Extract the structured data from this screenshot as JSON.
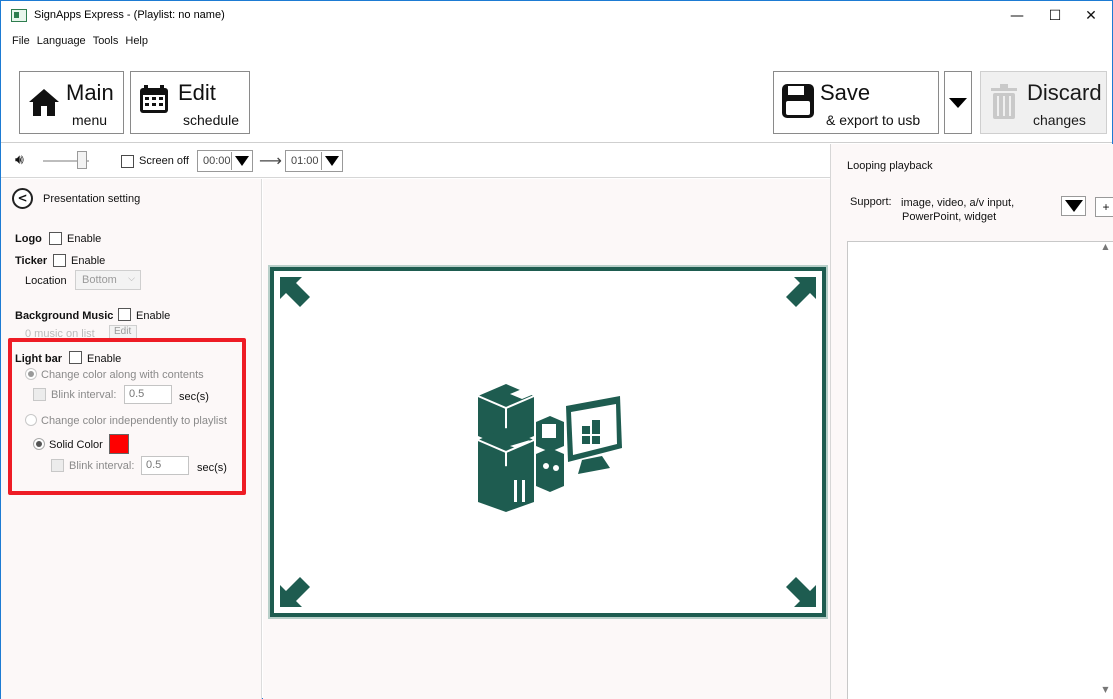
{
  "window": {
    "title": "SignApps Express - (Playlist: no name)",
    "minimize": "—",
    "maximize": "☐",
    "close": "✕"
  },
  "menu": [
    "File",
    "Language",
    "Tools",
    "Help"
  ],
  "toolbar": {
    "main": {
      "big": "Main",
      "small": "menu"
    },
    "edit": {
      "big": "Edit",
      "small": "schedule"
    },
    "save": {
      "big": "Save",
      "small": "& export to usb"
    },
    "discard": {
      "big": "Discard",
      "small": "changes"
    }
  },
  "controls": {
    "screen_off_label": "Screen off",
    "screen_off_checked": false,
    "time_from": "00:00",
    "time_to": "01:00",
    "volume_level": 0.75
  },
  "presentation": {
    "back_label": "Presentation setting",
    "logo": {
      "label": "Logo",
      "enable_label": "Enable"
    },
    "ticker": {
      "label": "Ticker",
      "enable_label": "Enable",
      "location_label": "Location",
      "location_value": "Bottom"
    },
    "bgmusic": {
      "label": "Background Music",
      "enable_label": "Enable",
      "count_text": "0 music on list",
      "edit_label": "Edit"
    },
    "lightbar": {
      "label": "Light bar",
      "enable_label": "Enable",
      "option1": "Change color along with contents",
      "blink1_label": "Blink interval:",
      "blink1_value": "0.5",
      "blink1_unit": "sec(s)",
      "option2": "Change color independently to playlist",
      "solid_label": "Solid Color",
      "solid_color": "#ff0000",
      "blink2_label": "Blink interval:",
      "blink2_value": "0.5",
      "blink2_unit": "sec(s)"
    }
  },
  "right": {
    "looping_label": "Looping playback",
    "support_label": "Support:",
    "support_line1": "image, video, a/v input,",
    "support_line2": "PowerPoint, widget",
    "plus_label": "+"
  },
  "colors": {
    "accent_green": "#1e5c50",
    "highlight_red": "#ee1c25"
  }
}
